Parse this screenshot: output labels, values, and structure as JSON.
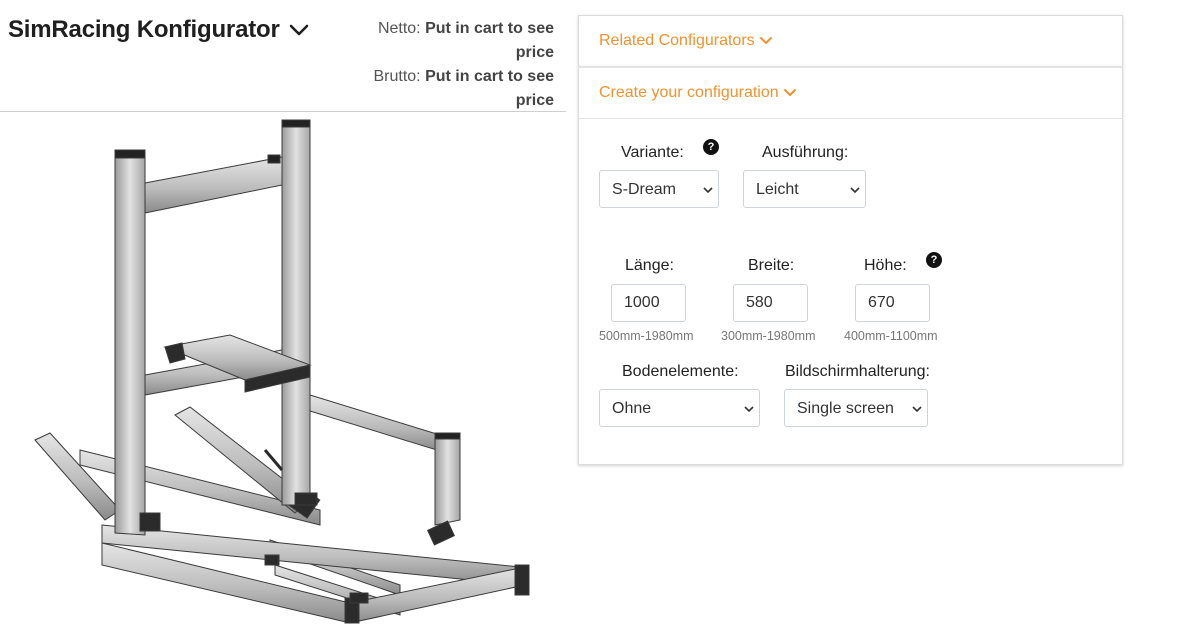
{
  "header": {
    "title": "SimRacing Konfigurator",
    "netto_label": "Netto:",
    "netto_value": "Put in cart to see price",
    "brutto_label": "Brutto:",
    "brutto_value": "Put in cart to see price"
  },
  "accordion": {
    "related": "Related Configurators",
    "create": "Create your configuration"
  },
  "form": {
    "variante": {
      "label": "Variante:",
      "value": "S-Dream"
    },
    "ausfuehrung": {
      "label": "Ausführung:",
      "value": "Leicht"
    },
    "laenge": {
      "label": "Länge:",
      "value": "1000",
      "range": "500mm-1980mm"
    },
    "breite": {
      "label": "Breite:",
      "value": "580",
      "range": "300mm-1980mm"
    },
    "hoehe": {
      "label": "Höhe:",
      "value": "670",
      "range": "400mm-1100mm"
    },
    "bodenelemente": {
      "label": "Bodenelemente:",
      "value": "Ohne"
    },
    "bildschirm": {
      "label": "Bildschirmhalterung:",
      "value": "Single screen"
    },
    "help_glyph": "?"
  },
  "colors": {
    "accent": "#f0922e",
    "frame": "#c9c9c9",
    "frame_dark": "#2b2b2b"
  }
}
